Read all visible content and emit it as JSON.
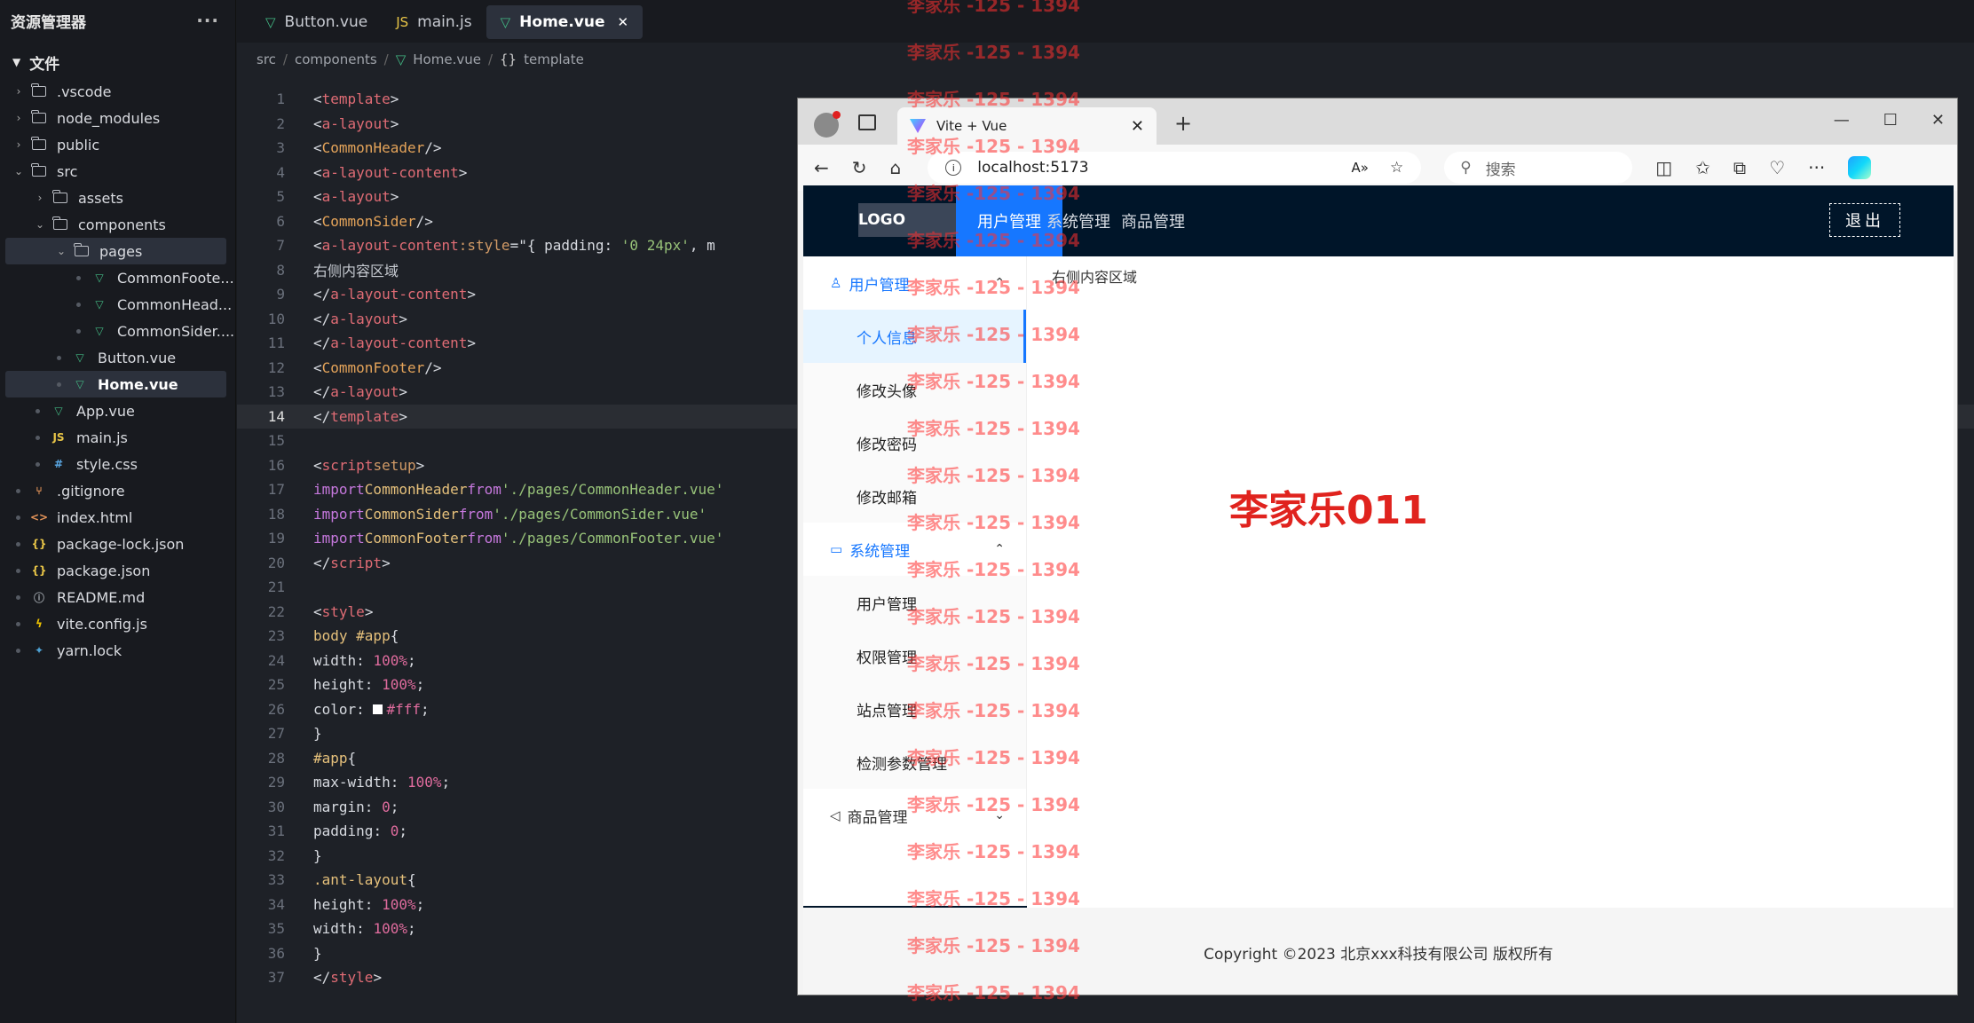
{
  "explorer": {
    "title": "资源管理器",
    "more": "···",
    "section": "文件",
    "items": [
      {
        "label": ".vscode",
        "icon": "folder-icon"
      },
      {
        "label": "node_modules",
        "icon": "folder-icon"
      },
      {
        "label": "public",
        "icon": "folder-icon"
      },
      {
        "label": "src",
        "icon": "folder-open-icon"
      },
      {
        "label": "assets",
        "icon": "folder-icon"
      },
      {
        "label": "components",
        "icon": "folder-open-icon"
      },
      {
        "label": "pages",
        "icon": "folder-open-icon"
      },
      {
        "label": "CommonFoote...",
        "icon": "vue-icon"
      },
      {
        "label": "CommonHead...",
        "icon": "vue-icon"
      },
      {
        "label": "CommonSider....",
        "icon": "vue-icon"
      },
      {
        "label": "Button.vue",
        "icon": "vue-icon"
      },
      {
        "label": "Home.vue",
        "icon": "vue-icon"
      },
      {
        "label": "App.vue",
        "icon": "vue-icon"
      },
      {
        "label": "main.js",
        "icon": "js-icon"
      },
      {
        "label": "style.css",
        "icon": "css-icon"
      },
      {
        "label": ".gitignore",
        "icon": "git-icon"
      },
      {
        "label": "index.html",
        "icon": "html-icon"
      },
      {
        "label": "package-lock.json",
        "icon": "json-icon"
      },
      {
        "label": "package.json",
        "icon": "json-icon"
      },
      {
        "label": "README.md",
        "icon": "info-icon"
      },
      {
        "label": "vite.config.js",
        "icon": "vite-icon"
      },
      {
        "label": "yarn.lock",
        "icon": "yarn-icon"
      }
    ]
  },
  "editor": {
    "tabs": [
      {
        "label": "Button.vue",
        "icon": "vue-icon"
      },
      {
        "label": "main.js",
        "icon": "js-icon"
      },
      {
        "label": "Home.vue",
        "icon": "vue-icon",
        "active": true
      }
    ],
    "breadcrumb": [
      "src",
      "components",
      "Home.vue",
      "template"
    ],
    "current_line": 14
  },
  "browser": {
    "tab_title": "Vite + Vue",
    "url": "localhost:5173",
    "search_placeholder": "搜索",
    "page": {
      "logo": "LOGO",
      "nav": [
        "用户管理",
        "系统管理",
        "商品管理"
      ],
      "logout": "退出",
      "content": "右侧内容区域",
      "name": "李家乐011",
      "sider": {
        "user_group": "用户管理",
        "user_items": [
          "个人信息",
          "修改头像",
          "修改密码",
          "修改邮箱"
        ],
        "system_group": "系统管理",
        "system_items": [
          "用户管理",
          "权限管理",
          "站点管理",
          "检测参数管理"
        ],
        "goods_group": "商品管理"
      },
      "footer": "Copyright ©2023 北京xxx科技有限公司 版权所有"
    }
  },
  "watermark": "李家乐 -125 - 1394"
}
